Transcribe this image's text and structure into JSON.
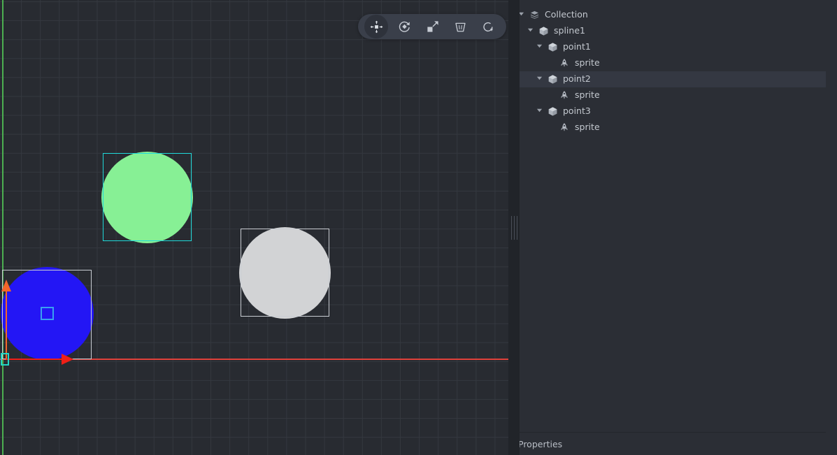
{
  "viewport": {
    "name": "scene-viewport",
    "background_color": "#282b31",
    "grid_color": "#34383f",
    "axis_x_color": "#e0413a",
    "axis_y_color": "#4caf50",
    "toolbar": {
      "buttons": [
        {
          "id": "move",
          "icon": "move-tool-icon",
          "label": "Move",
          "active": true
        },
        {
          "id": "rotate",
          "icon": "rotate-tool-icon",
          "label": "Rotate",
          "active": false
        },
        {
          "id": "scale",
          "icon": "scale-tool-icon",
          "label": "Scale",
          "active": false
        },
        {
          "id": "delete",
          "icon": "trash-icon",
          "label": "Delete",
          "active": false
        },
        {
          "id": "reset",
          "icon": "refresh-icon",
          "label": "Reset",
          "active": false
        }
      ]
    },
    "gizmo": {
      "type": "move-gizmo",
      "axis_x_color": "#f01f17",
      "axis_y_color": "#f4662a",
      "origin_handle_color": "#22d5c5",
      "center_handle_color": "#3aa0f0"
    },
    "objects": [
      {
        "id": "green-circle",
        "shape": "circle",
        "fill": "#87f095",
        "selected": true,
        "bbox_color": "#1fd8d8"
      },
      {
        "id": "gray-circle",
        "shape": "circle",
        "fill": "#d2d3d5",
        "selected": false,
        "bbox_color": "#c9cdd3"
      },
      {
        "id": "blue-circle",
        "shape": "circle",
        "fill": "#2316f5",
        "selected": false,
        "bbox_color": "#c9cdd3"
      }
    ]
  },
  "outliner": {
    "selected_row_color": "#343842",
    "selected_marker_color": "#f0712a",
    "rows": [
      {
        "label": "Collection",
        "icon": "collection-icon",
        "depth": 0,
        "expanded": true,
        "selected": false
      },
      {
        "label": "spline1",
        "icon": "object-cube-icon",
        "depth": 1,
        "expanded": true,
        "selected": false
      },
      {
        "label": "point1",
        "icon": "object-cube-icon",
        "depth": 2,
        "expanded": true,
        "selected": false
      },
      {
        "label": "sprite",
        "icon": "sprite-icon",
        "depth": 3,
        "expanded": null,
        "selected": false
      },
      {
        "label": "point2",
        "icon": "object-cube-icon",
        "depth": 2,
        "expanded": true,
        "selected": true
      },
      {
        "label": "sprite",
        "icon": "sprite-icon",
        "depth": 3,
        "expanded": null,
        "selected": false
      },
      {
        "label": "point3",
        "icon": "object-cube-icon",
        "depth": 2,
        "expanded": true,
        "selected": false
      },
      {
        "label": "sprite",
        "icon": "sprite-icon",
        "depth": 3,
        "expanded": null,
        "selected": false
      }
    ]
  },
  "properties": {
    "title": "Properties"
  }
}
